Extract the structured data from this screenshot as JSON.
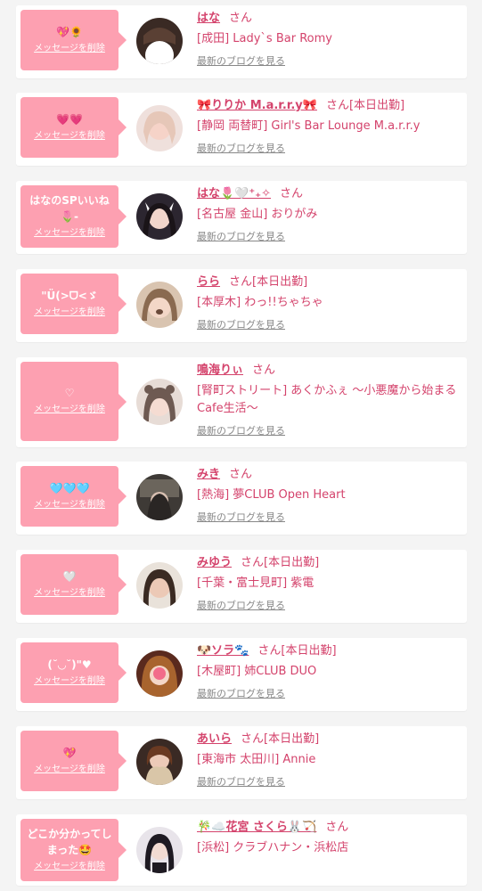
{
  "delete_label": "メッセージを削除",
  "blog_label": "最新のブログを見る",
  "san_label": "さん",
  "colors": {
    "accent": "#d4436c",
    "bubble": "#fda0b1",
    "background": "#f4f4f4"
  },
  "entries": [
    {
      "message": "💖🌻",
      "name": "はな",
      "status": "",
      "shop": "[成田] Lady`s Bar Romy",
      "avatar_icon": "blank-avatar-icon"
    },
    {
      "message": "💗💗",
      "name": "🎀りりか M.a.r.r.y🎀",
      "status": "[本日出勤]",
      "shop": "[静岡 両替町] Girl's Bar Lounge M.a.r.r.y",
      "avatar_icon": "avatar-photo-icon"
    },
    {
      "message": "はなのSPいいね🌷-",
      "name": "はな🌷🤍⁺₊✧",
      "status": "",
      "shop": "[名古屋 金山] おりがみ",
      "avatar_icon": "avatar-photo-icon"
    },
    {
      "message": "\"Ü(>ᗜ<ゞ",
      "name": "らら",
      "status": "[本日出勤]",
      "shop": "[本厚木] わっ!!ちゃちゃ",
      "avatar_icon": "avatar-photo-icon"
    },
    {
      "message": "♡",
      "name": "鳴海りぃ",
      "status": "",
      "shop": "[腎町ストリート] あくかふぇ 〜小悪魔から始まるCafe生活〜",
      "avatar_icon": "avatar-photo-icon"
    },
    {
      "message": "🩵🩵🩵",
      "name": "みき",
      "status": "",
      "shop": "[熱海] 夢CLUB Open Heart",
      "avatar_icon": "avatar-photo-icon"
    },
    {
      "message": "🤍",
      "name": "みゆう",
      "status": "[本日出勤]",
      "shop": "[千葉・富士見町] 紫電",
      "avatar_icon": "avatar-photo-icon"
    },
    {
      "message": "(˘◡˘)\"♥",
      "name": "🐶ソラ🐾",
      "status": "[本日出勤]",
      "shop": "[木屋町] 姉CLUB DUO",
      "avatar_icon": "avatar-photo-icon"
    },
    {
      "message": "💖",
      "name": "あいら",
      "status": "[本日出勤]",
      "shop": "[東海市 太田川] Annie",
      "avatar_icon": "avatar-photo-icon"
    },
    {
      "message": "どこか分かってしまった🤩",
      "name": "🎋☁️花宮 さくら🐰🏹",
      "status": "",
      "shop": "[浜松] クラブハナン・浜松店",
      "avatar_icon": "avatar-photo-icon"
    }
  ]
}
